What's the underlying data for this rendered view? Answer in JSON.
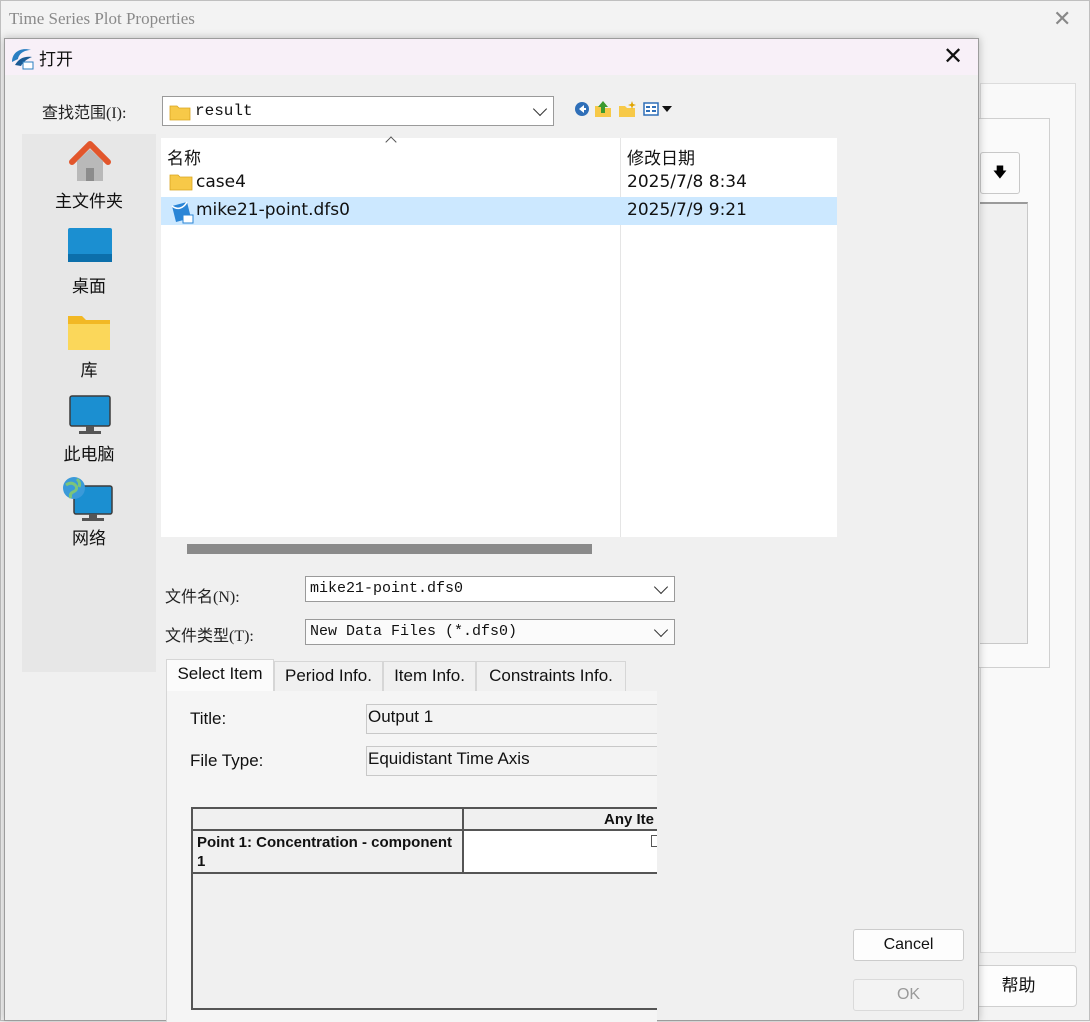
{
  "background_window": {
    "title": "Time Series Plot Properties",
    "help_label": "帮助"
  },
  "dialog": {
    "title": "打开",
    "lookin_label": "查找范围(I):",
    "lookin_value": "result",
    "places": [
      {
        "label": "主文件夹",
        "icon": "home-icon"
      },
      {
        "label": "桌面",
        "icon": "desktop-icon"
      },
      {
        "label": "库",
        "icon": "library-folder-icon"
      },
      {
        "label": "此电脑",
        "icon": "computer-icon"
      },
      {
        "label": "网络",
        "icon": "network-icon"
      }
    ],
    "columns": {
      "name": "名称",
      "date": "修改日期"
    },
    "files": [
      {
        "name": "case4",
        "date": "2025/7/8 8:34",
        "type": "folder",
        "selected": false
      },
      {
        "name": "mike21-point.dfs0",
        "date": "2025/7/9 9:21",
        "type": "dfs0",
        "selected": true
      }
    ],
    "filename_label": "文件名(N):",
    "filename_value": "mike21-point.dfs0",
    "filetype_label": "文件类型(T):",
    "filetype_value": "New Data Files (*.dfs0)",
    "tabs": [
      "Select Item",
      "Period Info.",
      "Item Info.",
      "Constraints Info."
    ],
    "form": {
      "title_label": "Title:",
      "title_value": "Output 1",
      "filetype_label": "File Type:",
      "filetype_value": "Equidistant Time Axis",
      "grid_header_col2": "Any Ite",
      "grid_row1_col1": "Point 1: Concentration - component 1"
    },
    "cancel_label": "Cancel",
    "ok_label": "OK"
  }
}
